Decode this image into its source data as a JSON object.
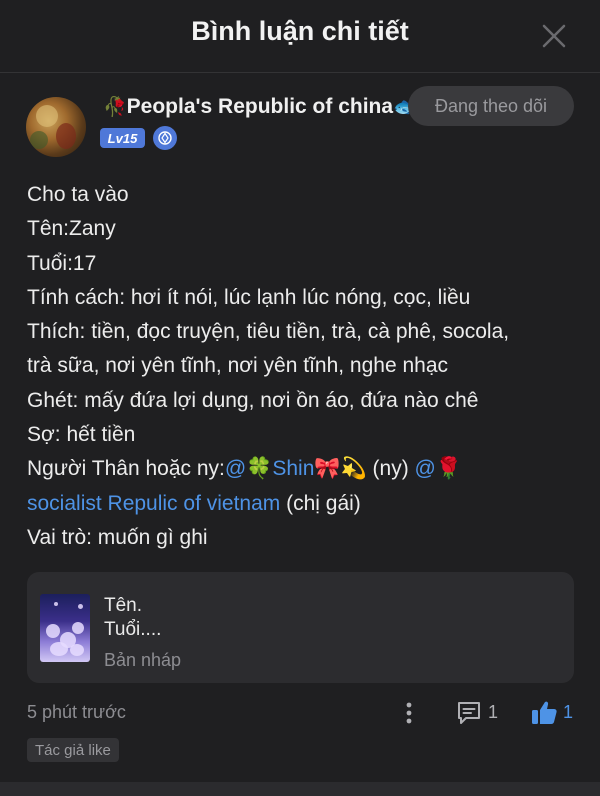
{
  "header": {
    "title": "Bình luận chi tiết",
    "close_icon": "close-icon"
  },
  "author": {
    "name": "Peopla's Republic of china",
    "name_prefix_emoji": "🥀",
    "name_suffix_emoji": "🐟",
    "level": "Lv15",
    "follow_label": "Đang theo dõi",
    "avatar_icon": "avatar"
  },
  "comment": {
    "lines": [
      "Cho ta vào",
      "Tên:Zany",
      "Tuổi:17",
      "Tính cách: hơi ít nói, lúc lạnh lúc nóng, cọc, liều",
      "Thích: tiền, đọc truyện, tiêu tiền, trà, cà phê, socola,",
      "trà sữa, nơi yên tĩnh, nơi yên tĩnh, nghe nhạc",
      "Ghét: mấy đứa lợi dụng, nơi ồn áo, đứa nào chê",
      "Sợ: hết tiền"
    ],
    "relation_prefix": "Người Thân hoặc ny:",
    "mention1": "@🍀Shin🎀💫",
    "relation_mid": "  (ny) ",
    "mention2_at": "@🌹",
    "mention2_name": "socialist Repulic of vietnam",
    "relation_suffix": " (chị gái)",
    "last_line": "Vai trò: muốn gì ghi"
  },
  "draft": {
    "line1": "Tên.",
    "line2": "Tuổi....",
    "label": "Bản nháp"
  },
  "footer": {
    "time": "5 phút trước",
    "comment_count": "1",
    "like_count": "1",
    "author_tag": "Tác giả like"
  },
  "colors": {
    "background": "#1f1f21",
    "accent": "#4e93e6",
    "level_badge": "#4f78d8"
  }
}
